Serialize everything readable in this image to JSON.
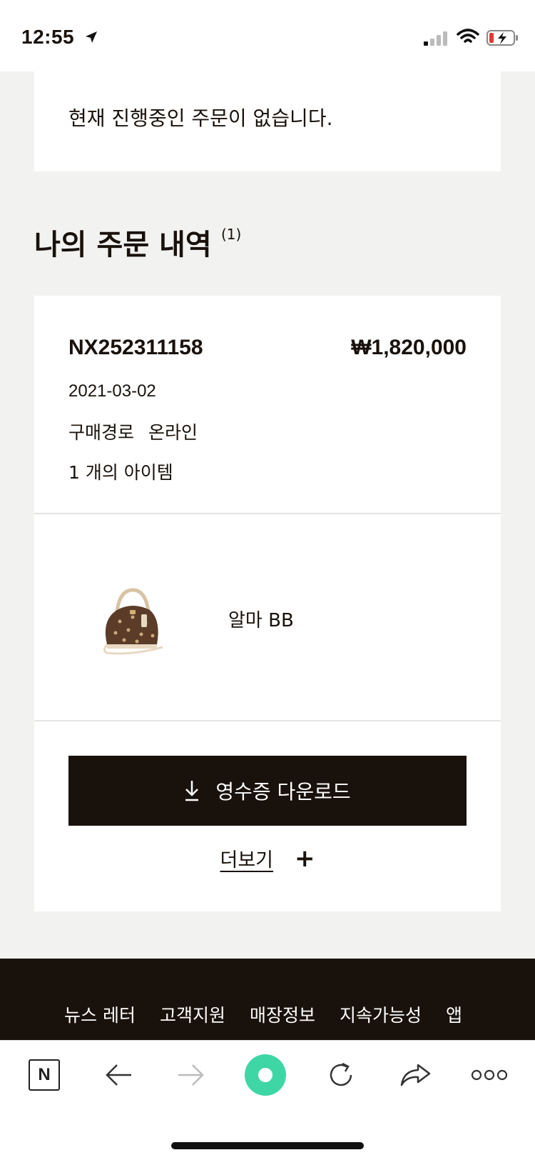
{
  "status_bar": {
    "time": "12:55"
  },
  "current_orders": {
    "empty_message": "현재 진행중인 주문이 없습니다."
  },
  "history": {
    "title": "나의 주문 내역",
    "count": "(1)"
  },
  "order": {
    "id": "NX252311158",
    "price": "₩1,820,000",
    "date": "2021-03-02",
    "channel_label": "구매경로",
    "channel_value": "온라인",
    "item_count": "1 개의 아이템",
    "product_name": "알마 BB",
    "download_label": "영수증 다운로드",
    "more_label": "더보기"
  },
  "footer": {
    "links": [
      "뉴스 레터",
      "고객지원",
      "매장정보",
      "지속가능성",
      "앱"
    ]
  },
  "colors": {
    "brand_dark": "#19110b",
    "background": "#f2f2f0",
    "reload_accent": "#3fd6a5"
  }
}
